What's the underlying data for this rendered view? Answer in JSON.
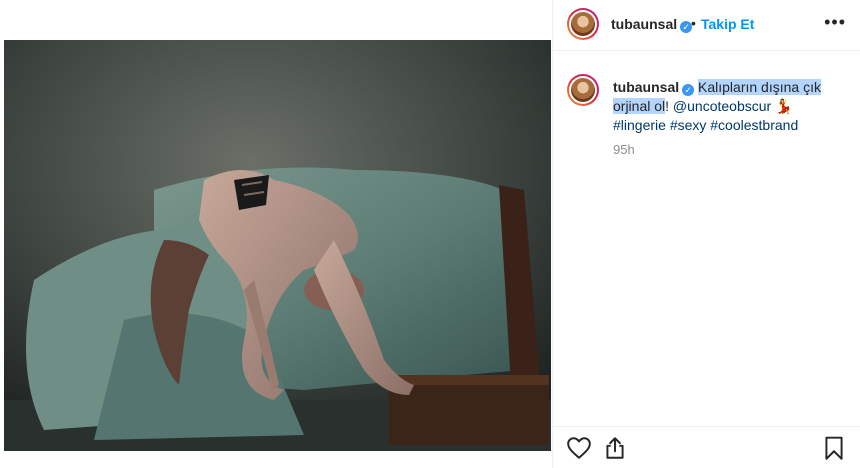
{
  "post": {
    "username": "tubaunsal",
    "verified_icon": "verified-badge-icon",
    "separator": "•",
    "follow_label": "Takip Et",
    "more_label": "•••"
  },
  "caption": {
    "username": "tubaunsal",
    "text_highlighted": "Kalıpların dışına çık orjinal ol",
    "text_after": "!",
    "mention": "@uncoteobscur",
    "emoji": "💃",
    "hashtags": "#lingerie #sexy #coolestbrand",
    "time": "95h"
  },
  "actions": {
    "like_icon": "heart-icon",
    "share_icon": "share-icon",
    "save_icon": "bookmark-icon"
  },
  "colors": {
    "accent": "#0095f6",
    "verified": "#3897f0",
    "highlight": "#b3d4fc",
    "link": "#00376b",
    "muted": "#8e8e8e"
  }
}
